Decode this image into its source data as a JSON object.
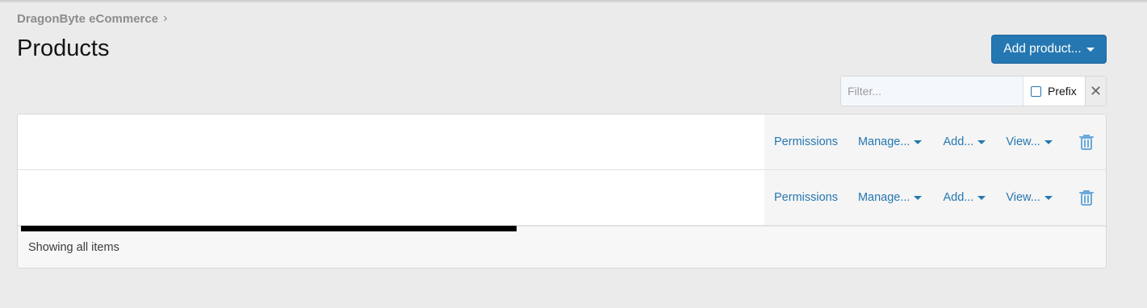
{
  "breadcrumb": {
    "item": "DragonByte eCommerce",
    "separator_icon": "chevron-right-icon"
  },
  "page": {
    "title": "Products"
  },
  "add_button": {
    "label": "Add product..."
  },
  "filter": {
    "placeholder": "Filter...",
    "prefix_label": "Prefix",
    "clear_icon": "close-icon"
  },
  "rows": [
    {
      "actions": {
        "permissions": "Permissions",
        "manage": "Manage...",
        "add": "Add...",
        "view": "View..."
      },
      "delete_icon": "trash-icon"
    },
    {
      "actions": {
        "permissions": "Permissions",
        "manage": "Manage...",
        "add": "Add...",
        "view": "View..."
      },
      "delete_icon": "trash-icon"
    }
  ],
  "footer": {
    "text": "Showing all items"
  },
  "colors": {
    "accent": "#2577b1",
    "background": "#ebebeb"
  }
}
